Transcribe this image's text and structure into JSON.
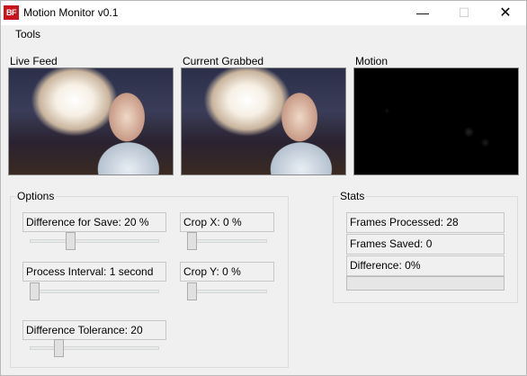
{
  "window": {
    "icon_text": "BF",
    "title": "Motion Monitor v0.1",
    "minimize_glyph": "—",
    "maximize_glyph": "☐",
    "close_glyph": "✕"
  },
  "menu": {
    "tools": "Tools"
  },
  "panes": {
    "live": "Live Feed",
    "grabbed": "Current Grabbed",
    "motion": "Motion"
  },
  "options": {
    "title": "Options",
    "difference_for_save": {
      "label": "Difference for Save: 20 %",
      "value": 0.3
    },
    "process_interval": {
      "label": "Process Interval: 1 second",
      "value": 0.0
    },
    "difference_tolerance": {
      "label": "Difference Tolerance: 20",
      "value": 0.2
    },
    "crop_x": {
      "label": "Crop X: 0 %",
      "value": 0.0
    },
    "crop_y": {
      "label": "Crop Y: 0 %",
      "value": 0.0
    }
  },
  "stats": {
    "title": "Stats",
    "frames_processed": "Frames Processed: 28",
    "frames_saved": "Frames Saved: 0",
    "difference": "Difference: 0%",
    "progress_value": 0
  },
  "colors": {
    "icon_bg": "#c8141c",
    "progress_fill": "#06b025"
  }
}
